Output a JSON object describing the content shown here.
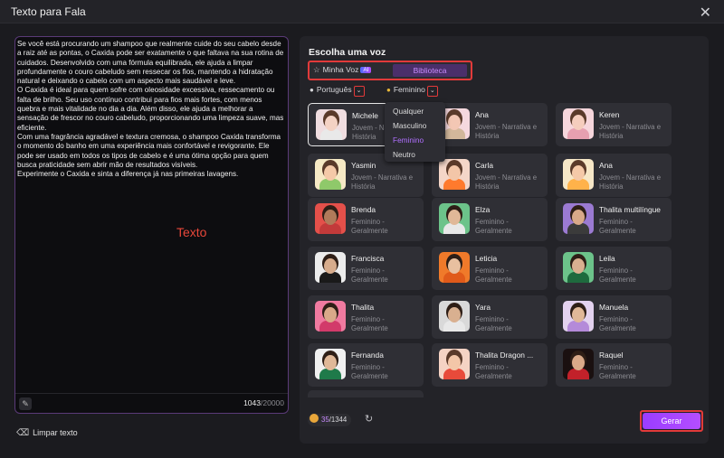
{
  "window": {
    "title": "Texto para Fala"
  },
  "editor": {
    "text": "Se você está procurando um shampoo que realmente cuide do seu cabelo desde a raiz até as pontas, o Caxida pode ser exatamente o que faltava na sua rotina de cuidados. Desenvolvido com uma fórmula equilibrada, ele ajuda a limpar profundamente o couro cabeludo sem ressecar os fios, mantendo a hidratação natural e deixando o cabelo com um aspecto mais saudável e leve.\nO Caxida é ideal para quem sofre com oleosidade excessiva, ressecamento ou falta de brilho. Seu uso contínuo contribui para fios mais fortes, com menos quebra e mais vitalidade no dia a dia. Além disso, ele ajuda a melhorar a sensação de frescor no couro cabeludo, proporcionando uma limpeza suave, mas eficiente.\nCom uma fragrância agradável e textura cremosa, o shampoo Caxida transforma o momento do banho em uma experiência mais confortável e revigorante. Ele pode ser usado em todos os tipos de cabelo e é uma ótima opção para quem busca praticidade sem abrir mão de resultados visíveis.\nExperimente o Caxida e sinta a diferença já nas primeiras lavagens.",
    "watermark": "Texto",
    "count": "1043",
    "max": "/20000"
  },
  "clear_label": "Limpar texto",
  "voice_panel": {
    "title": "Escolha uma voz",
    "tab_my_voice": "Minha Voz",
    "ai_badge": "AI",
    "tab_library": "Biblioteca",
    "filter_language": "Português",
    "filter_gender": "Feminino",
    "gender_options": [
      "Qualquer",
      "Masculino",
      "Feminino",
      "Neutro"
    ],
    "gender_selected": "Feminino"
  },
  "voices": [
    {
      "name": "Michele",
      "desc": "Jovem - Narrativa e História",
      "selected": true,
      "style": "cartoon",
      "skin": "#f4d2c4",
      "shirt": "#e9e9e9",
      "bg": "#f0dde0"
    },
    {
      "name": "Ana",
      "desc": "Jovem - Narrativa e História",
      "style": "cartoon",
      "skin": "#f3c7b4",
      "shirt": "#d2b79b",
      "bg": "#f5d8de"
    },
    {
      "name": "Keren",
      "desc": "Jovem - Narrativa e História",
      "style": "cartoon",
      "skin": "#f5cdbd",
      "shirt": "#e6a0b0",
      "bg": "#f6d6dc"
    },
    {
      "name": "Yasmin",
      "desc": "Jovem - Narrativa e História",
      "style": "cartoon",
      "skin": "#f5c9a8",
      "shirt": "#8fc96a",
      "bg": "#f6e9c5"
    },
    {
      "name": "Carla",
      "desc": "Jovem - Narrativa e História",
      "style": "cartoon",
      "skin": "#f3c6a8",
      "shirt": "#ff7a2d",
      "bg": "#f4d6c8"
    },
    {
      "name": "Ana",
      "desc": "Jovem - Narrativa e História",
      "style": "cartoon",
      "skin": "#f5c9a8",
      "shirt": "#ffb24a",
      "bg": "#f6e7c7"
    },
    {
      "name": "Brenda",
      "desc": "Feminino - Geralmente",
      "style": "photo",
      "skin": "#b07a5a",
      "shirt": "#c23a3a",
      "bg": "#e4504a"
    },
    {
      "name": "Elza",
      "desc": "Feminino - Geralmente",
      "style": "photo",
      "skin": "#e0b898",
      "shirt": "#e8e8e8",
      "bg": "#6cc38a"
    },
    {
      "name": "Thalita multilíngue",
      "desc": "Feminino - Geralmente",
      "style": "photo",
      "skin": "#d9a989",
      "shirt": "#3b3b3b",
      "bg": "#9b7ad2"
    },
    {
      "name": "Francisca",
      "desc": "Feminino - Geralmente",
      "style": "photo",
      "skin": "#d7ac8c",
      "shirt": "#1a1a1a",
      "bg": "#ececec"
    },
    {
      "name": "Leticia",
      "desc": "Feminino - Geralmente",
      "style": "photo",
      "skin": "#e8c0a0",
      "shirt": "#e05a1a",
      "bg": "#f07a2a"
    },
    {
      "name": "Leila",
      "desc": "Feminino - Geralmente",
      "style": "photo",
      "skin": "#d9b090",
      "shirt": "#1e6a3e",
      "bg": "#6cc38a"
    },
    {
      "name": "Thalita",
      "desc": "Feminino - Geralmente",
      "style": "photo",
      "skin": "#d9a989",
      "shirt": "#d23a6a",
      "bg": "#f07aa0"
    },
    {
      "name": "Yara",
      "desc": "Feminino - Geralmente",
      "style": "photo",
      "skin": "#d9b090",
      "shirt": "#e8e8e8",
      "bg": "#d9d9d9"
    },
    {
      "name": "Manuela",
      "desc": "Feminino - Geralmente",
      "style": "photo",
      "skin": "#e0b898",
      "shirt": "#b48ad9",
      "bg": "#e3d2ef"
    },
    {
      "name": "Fernanda",
      "desc": "Feminino - Geralmente",
      "style": "photo",
      "skin": "#e0b898",
      "shirt": "#1f7a4a",
      "bg": "#f0f0f0"
    },
    {
      "name": "Thalita Dragon ...",
      "desc": "Feminino - Geralmente",
      "style": "cartoon",
      "skin": "#f3c6a8",
      "shirt": "#e84a3a",
      "bg": "#f5d3c4"
    },
    {
      "name": "Raquel",
      "desc": "Feminino - Geralmente",
      "style": "photo",
      "skin": "#d9a989",
      "shirt": "#c2212a",
      "bg": "#1a1010"
    }
  ],
  "credits": {
    "current": "35",
    "total": "/1344"
  },
  "generate_label": "Gerar",
  "colors": {
    "accent": "#a855f7",
    "highlight_box": "#e23a3a",
    "panel": "#232328",
    "background": "#1b1b1f"
  }
}
